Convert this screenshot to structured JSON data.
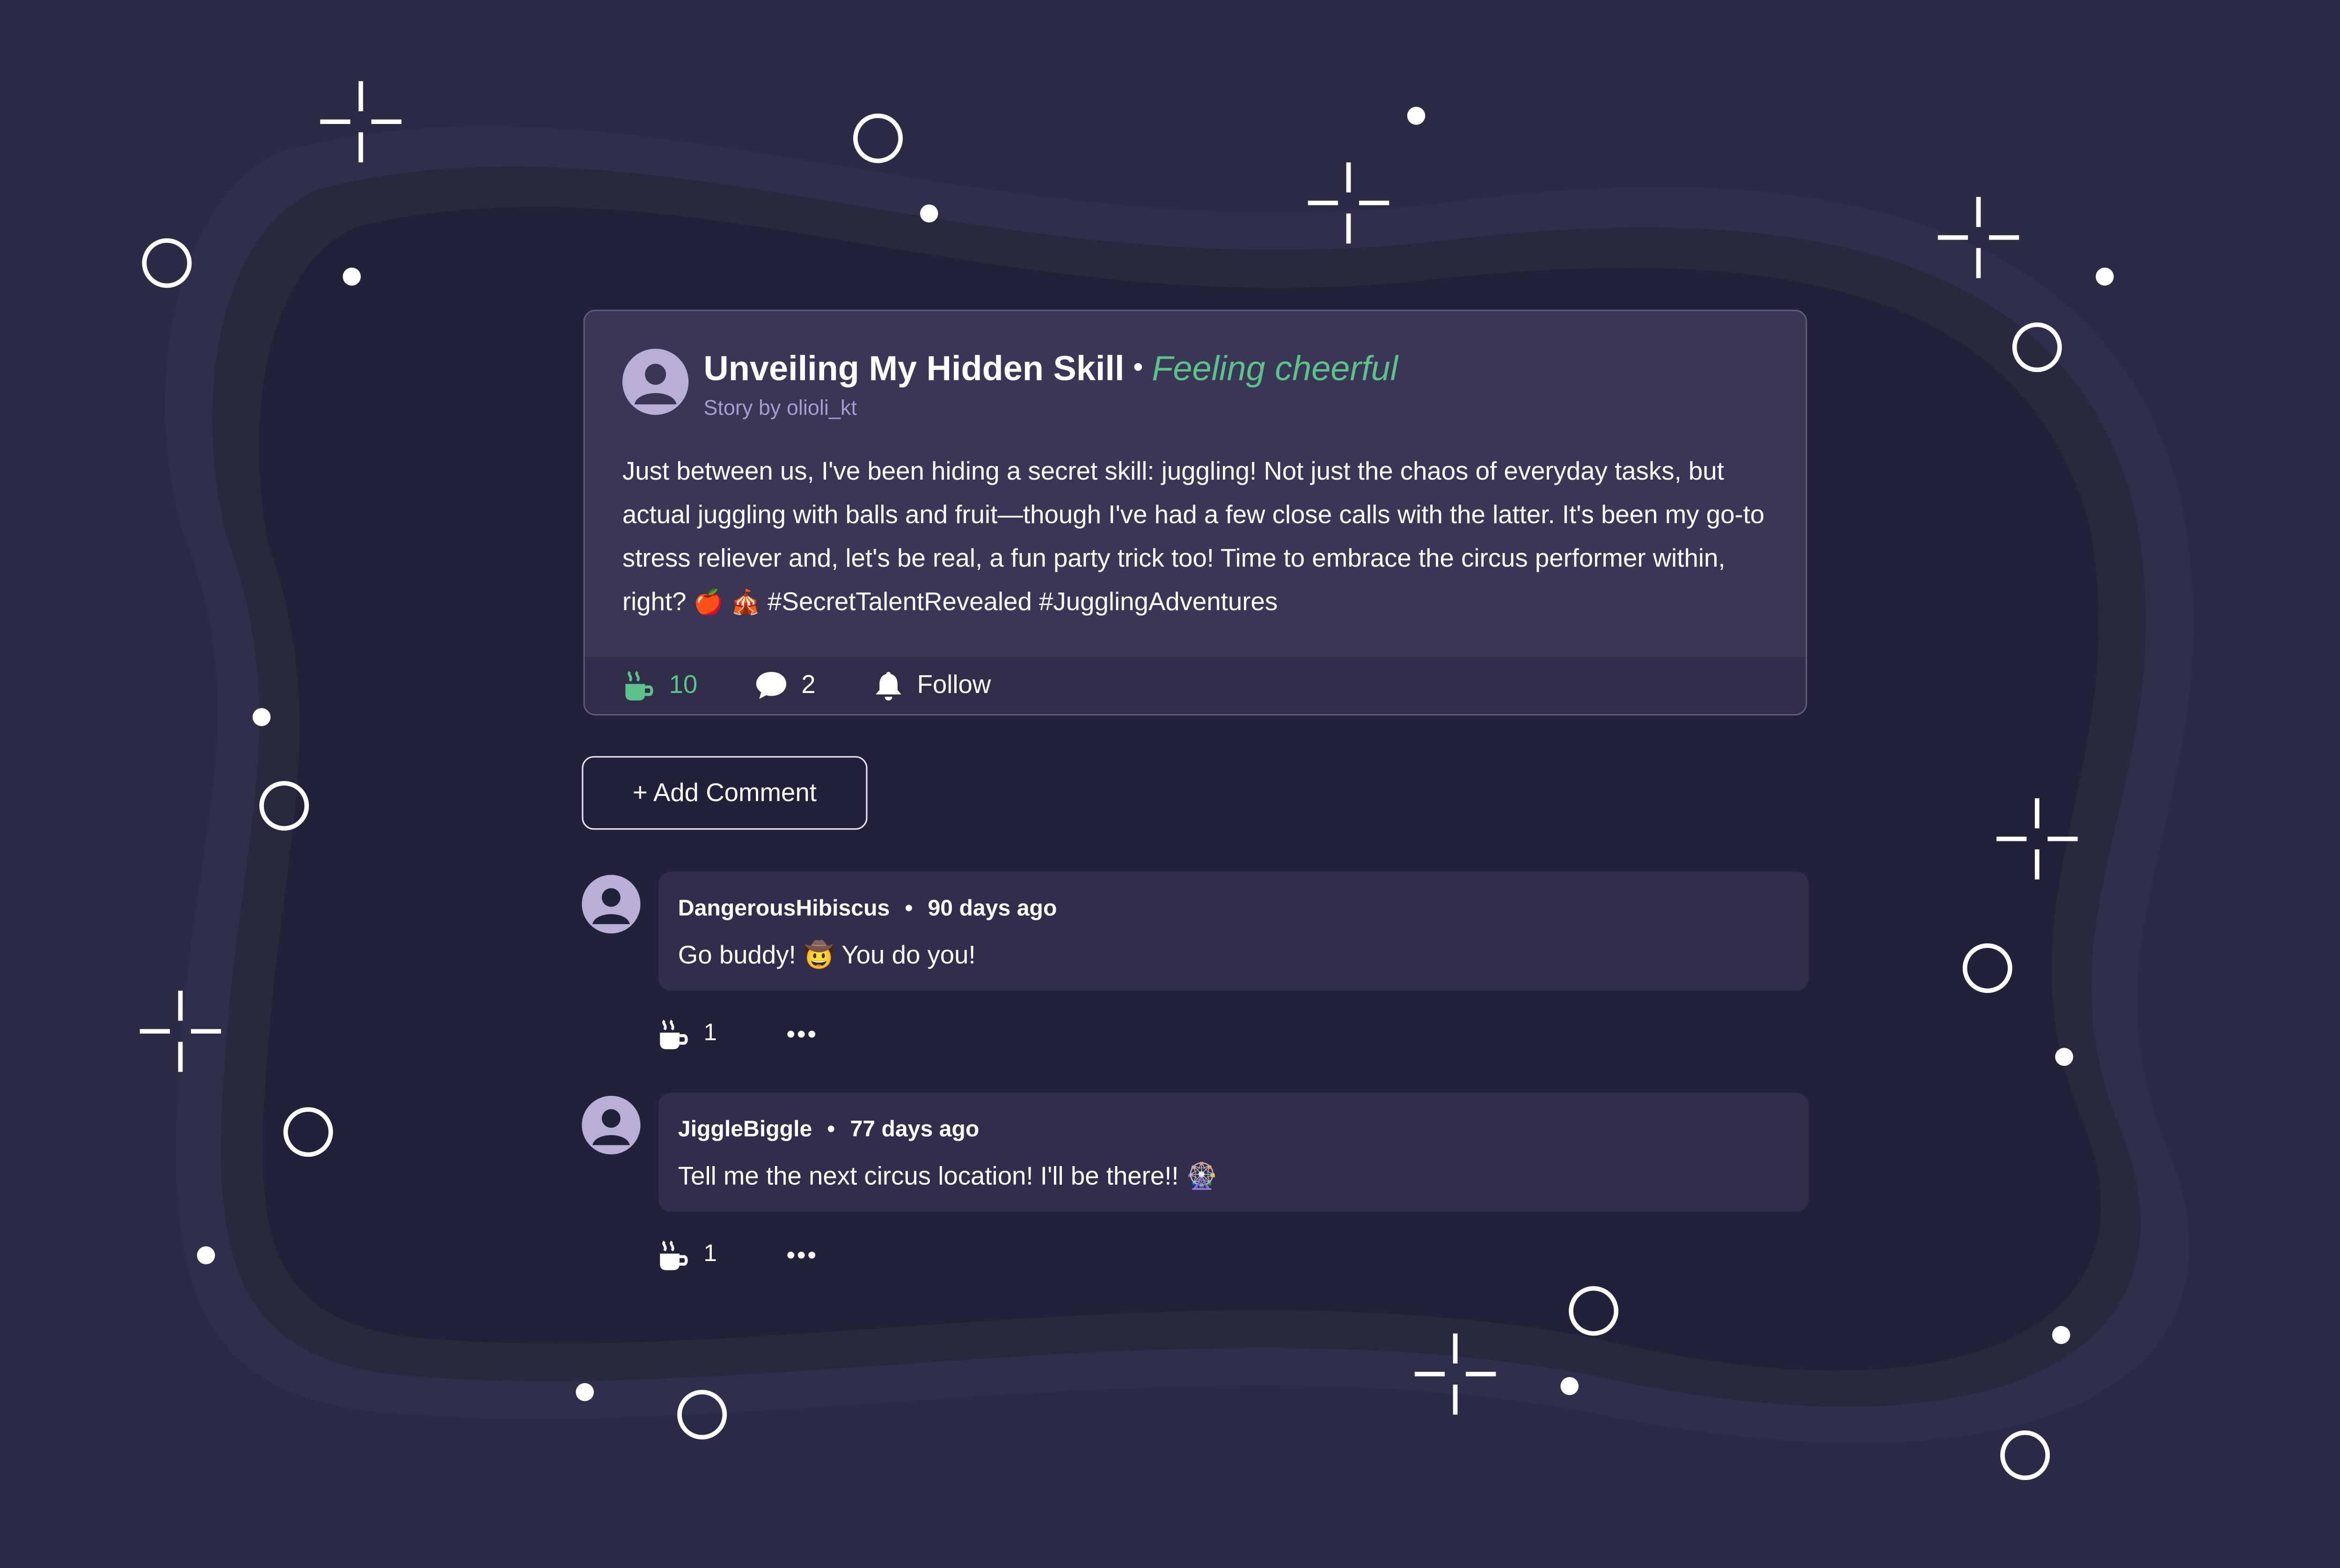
{
  "post": {
    "title": "Unveiling My Hidden Skill",
    "separator": "•",
    "mood": "Feeling cheerful",
    "byline": "Story by olioli_kt",
    "body_text": "Just between us, I've been hiding a secret skill: juggling! Not just the chaos of everyday tasks, but actual juggling with balls and fruit—though I've had a few close calls with the latter. It's been my go-to stress reliever and, let's be real, a fun party trick too! Time to embrace the circus performer within, right?",
    "emoji_1": "🍎",
    "emoji_2": "🎪",
    "hashtags": "#SecretTalentRevealed #JugglingAdventures",
    "cheers_count": "10",
    "comments_count": "2",
    "follow_label": "Follow"
  },
  "add_comment_label": "+ Add Comment",
  "comments": [
    {
      "author": "DangerousHibiscus",
      "dot": "•",
      "time": "90 days ago",
      "text_before": "Go buddy!",
      "emoji": "🤠",
      "text_after": "You do you!",
      "cheers": "1"
    },
    {
      "author": "JiggleBiggle",
      "dot": "•",
      "time": "77 days ago",
      "text_before": "Tell me the next circus location! I'll be there!!",
      "emoji": "🎡",
      "text_after": "",
      "cheers": "1"
    }
  ],
  "colors": {
    "background": "#2b2b45",
    "card": "#3a3756",
    "accent_green": "#5cc28a",
    "byline_purple": "#a79bd0"
  },
  "icons": {
    "cheers": "coffee-cup-icon",
    "comments": "speech-bubble-icon",
    "follow": "bell-icon",
    "more": "ellipsis-icon",
    "avatar": "user-avatar-icon"
  }
}
